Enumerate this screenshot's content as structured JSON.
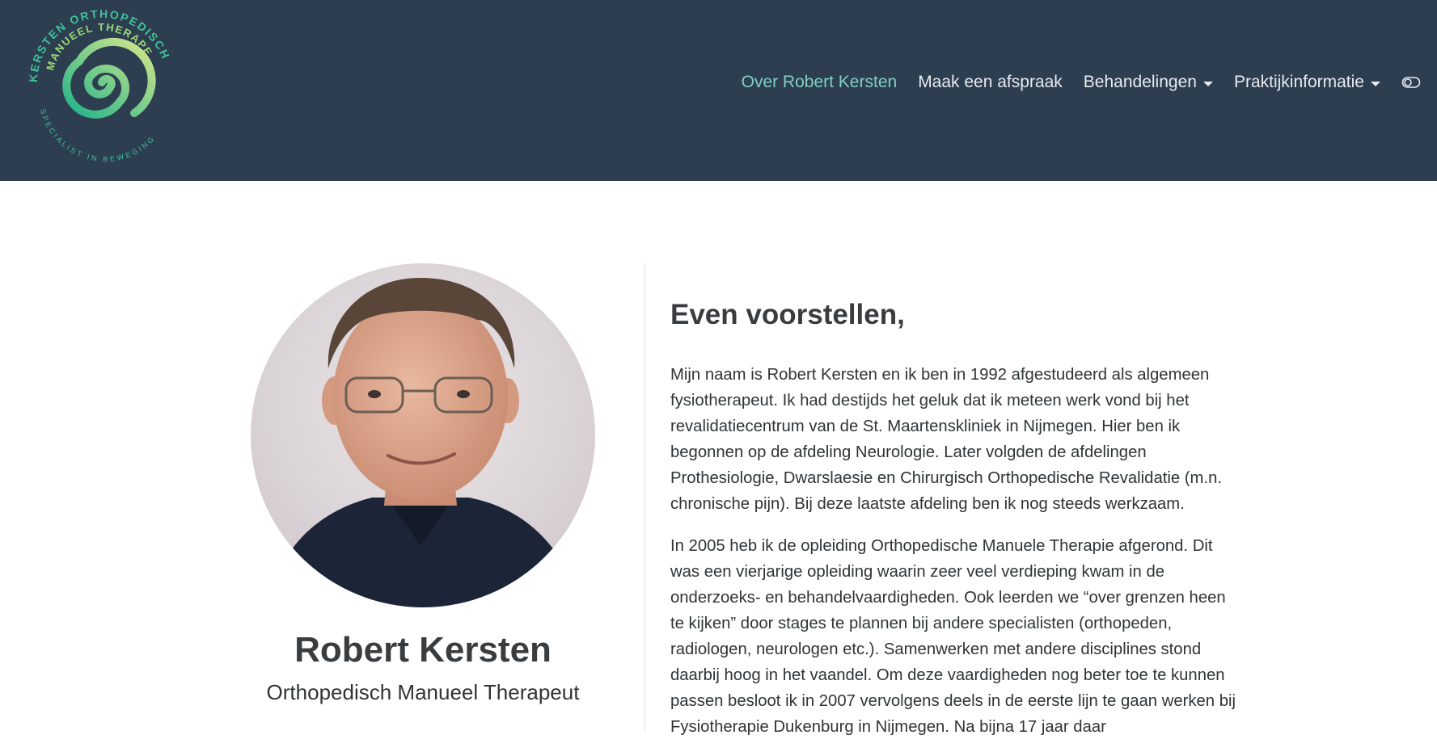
{
  "header": {
    "logo": {
      "arc_top_text": "KERSTEN ORTHOPEDISCH",
      "arc_mid_text": "MANUEEL THERAPEUT",
      "arc_bottom_text": "SPECIALIST IN BEWEGING",
      "gradient_start": "#1fb38a",
      "gradient_end": "#d9e88c"
    },
    "nav": [
      {
        "label": "Over Robert Kersten",
        "active": true
      },
      {
        "label": "Maak een afspraak"
      },
      {
        "label": "Behandelingen",
        "dropdown": true
      },
      {
        "label": "Praktijkinformatie",
        "dropdown": true
      }
    ],
    "toggle_icon": "toggle-icon"
  },
  "colors": {
    "header_bg": "#2d3e50",
    "nav_text": "#e6ebef",
    "nav_active": "#7fd0c1",
    "body_text": "#2f3437"
  },
  "profile": {
    "name": "Robert Kersten",
    "role": "Orthopedisch Manueel Therapeut"
  },
  "intro": {
    "heading": "Even voorstellen,",
    "paragraphs": [
      "Mijn naam is Robert Kersten en ik ben in 1992 afgestudeerd als algemeen fysiotherapeut. Ik had destijds het geluk dat ik meteen werk vond bij het revalidatiecentrum van de St. Maartenskliniek in Nijmegen. Hier ben ik begonnen op de afdeling Neurologie. Later volgden de afdelingen Prothesiologie, Dwarslaesie en Chirurgisch Orthopedische Revalidatie (m.n. chronische pijn). Bij deze laatste afdeling ben ik nog steeds werkzaam.",
      "In 2005 heb ik de opleiding Orthopedische Manuele Therapie afgerond. Dit was een vierjarige opleiding waarin zeer veel verdieping kwam in de onderzoeks- en behandelvaardigheden. Ook leerden we “over grenzen heen te kijken” door stages te plannen bij andere specialisten (orthopeden, radiologen, neurologen etc.). Samenwerken met andere disciplines stond daarbij hoog in het vaandel. Om deze vaardigheden nog beter toe te kunnen passen besloot ik in 2007 vervolgens deels in de eerste lijn te gaan werken bij Fysiotherapie Dukenburg in Nijmegen. Na bijna 17 jaar daar"
    ]
  }
}
